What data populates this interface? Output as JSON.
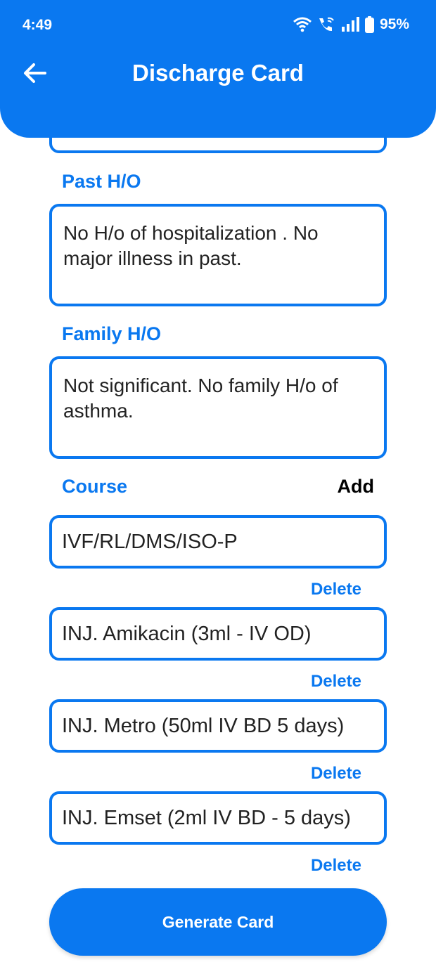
{
  "status_bar": {
    "time": "4:49",
    "battery": "95%"
  },
  "header": {
    "title": "Discharge Card"
  },
  "past_history": {
    "label": "Past H/O",
    "value": "No H/o of hospitalization . No major illness in past."
  },
  "family_history": {
    "label": "Family H/O",
    "value": "Not significant. No family H/o of asthma."
  },
  "course": {
    "label": "Course",
    "add_label": "Add",
    "delete_label": "Delete",
    "items": [
      "IVF/RL/DMS/ISO-P",
      "INJ. Amikacin (3ml - IV OD)",
      "INJ. Metro (50ml  IV BD 5 days)",
      "INJ. Emset (2ml IV BD - 5 days)"
    ]
  },
  "generate_button": {
    "label": "Generate Card"
  },
  "colors": {
    "primary": "#0a78f0",
    "background": "#ffffff"
  }
}
